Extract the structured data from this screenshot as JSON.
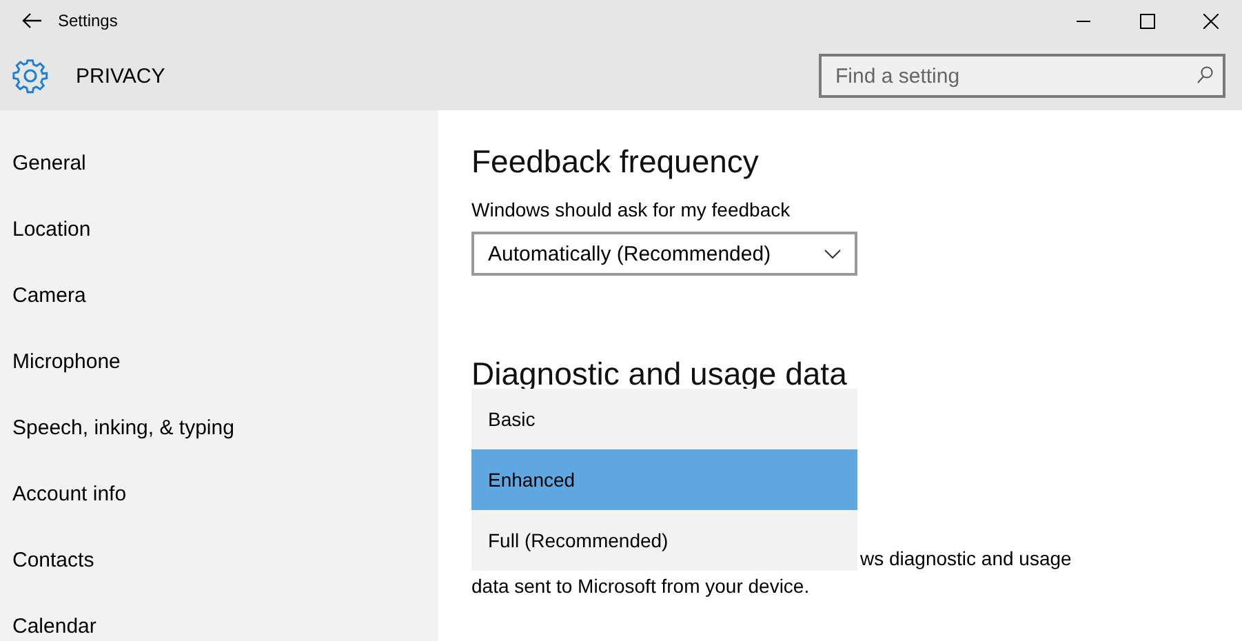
{
  "window": {
    "title": "Settings"
  },
  "header": {
    "title": "PRIVACY",
    "search": {
      "placeholder": "Find a setting"
    }
  },
  "sidebar": {
    "items": [
      {
        "label": "General"
      },
      {
        "label": "Location"
      },
      {
        "label": "Camera"
      },
      {
        "label": "Microphone"
      },
      {
        "label": "Speech, inking, & typing"
      },
      {
        "label": "Account info"
      },
      {
        "label": "Contacts"
      },
      {
        "label": "Calendar"
      }
    ]
  },
  "feedback": {
    "heading": "Feedback frequency",
    "label": "Windows should ask for my feedback",
    "value": "Automatically (Recommended)"
  },
  "diagnostics": {
    "heading": "Diagnostic and usage data",
    "options": [
      {
        "label": "Basic",
        "selected": false
      },
      {
        "label": "Enhanced",
        "selected": true
      },
      {
        "label": "Full (Recommended)",
        "selected": false
      }
    ],
    "description_lines": [
      "ws diagnostic and usage",
      "data sent to Microsoft from your device."
    ]
  }
}
